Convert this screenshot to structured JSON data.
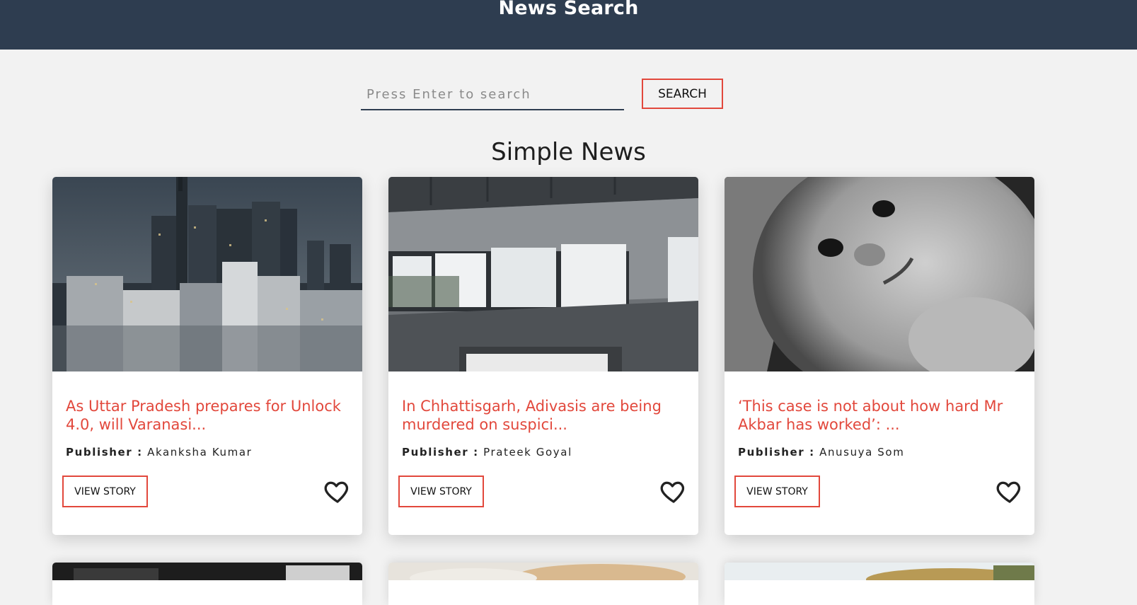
{
  "header": {
    "title": "News Search"
  },
  "search": {
    "placeholder": "Press Enter to search",
    "value": "",
    "button_label": "SEARCH"
  },
  "section": {
    "title": "Simple News"
  },
  "cards": [
    {
      "title": "As Uttar Pradesh prepares for Unlock 4.0, will Varanasi...",
      "publisher_label": "Publisher :",
      "publisher_name": "Akanksha Kumar",
      "button_label": "VIEW STORY",
      "favorited": false
    },
    {
      "title": "In Chhattisgarh, Adivasis are being murdered on suspici...",
      "publisher_label": "Publisher :",
      "publisher_name": "Prateek Goyal",
      "button_label": "VIEW STORY",
      "favorited": false
    },
    {
      "title": "‘This case is not about how hard Mr Akbar has worked’: ...",
      "publisher_label": "Publisher :",
      "publisher_name": "Anusuya Som",
      "button_label": "VIEW STORY",
      "favorited": false
    }
  ],
  "icons": {
    "favorite": "heart-outline-icon"
  },
  "colors": {
    "header_bg": "#2e3d50",
    "accent": "#e2483c",
    "page_bg": "#f2f2f2"
  }
}
